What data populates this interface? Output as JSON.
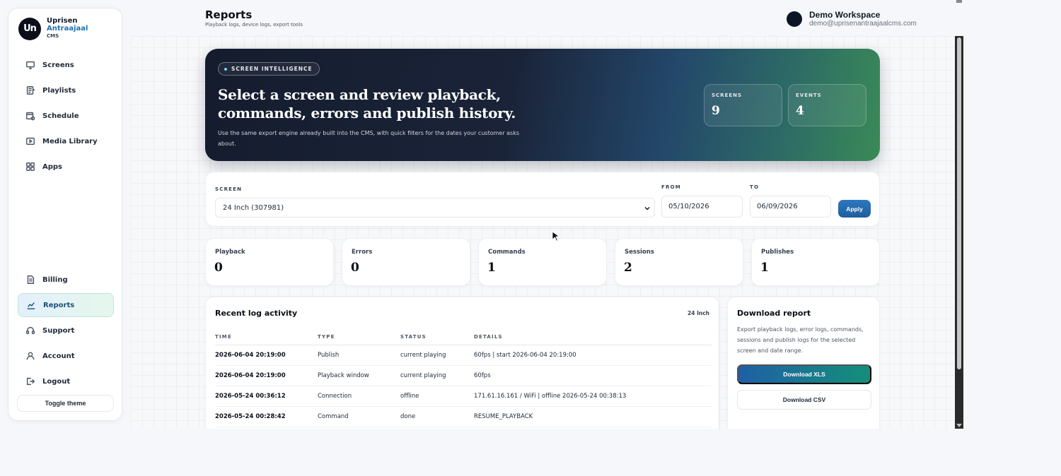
{
  "brand": {
    "logo": "Un",
    "line1": "Uprisen",
    "line2": "Antraajaal",
    "line3": "CMS"
  },
  "sidebar": {
    "top_items": [
      {
        "label": "Screens",
        "icon": "monitor-icon"
      },
      {
        "label": "Playlists",
        "icon": "playlist-icon"
      },
      {
        "label": "Schedule",
        "icon": "calendar-icon"
      },
      {
        "label": "Media Library",
        "icon": "media-icon"
      },
      {
        "label": "Apps",
        "icon": "apps-icon"
      }
    ],
    "bottom_items": [
      {
        "label": "Billing",
        "icon": "document-icon"
      },
      {
        "label": "Reports",
        "icon": "chart-icon",
        "active": true
      },
      {
        "label": "Support",
        "icon": "headset-icon"
      },
      {
        "label": "Account",
        "icon": "user-icon"
      },
      {
        "label": "Logout",
        "icon": "logout-icon"
      }
    ],
    "toggle_theme": "Toggle theme"
  },
  "header": {
    "title": "Reports",
    "subtitle": "Playback logs, device logs, export tools",
    "workspace_name": "Demo Workspace",
    "workspace_email": "demo@uprisenantraajaalcms.com"
  },
  "hero": {
    "chip": "SCREEN INTELLIGENCE",
    "title": "Select a screen and review playback, commands, errors and publish history.",
    "description": "Use the same export engine already built into the CMS, with quick filters for the dates your customer asks about.",
    "stats": [
      {
        "label": "SCREENS",
        "value": "9"
      },
      {
        "label": "EVENTS",
        "value": "4"
      }
    ]
  },
  "filter": {
    "screen_label": "SCREEN",
    "screen_value": "24 Inch (307981)",
    "from_label": "FROM",
    "from_value": "05/10/2026",
    "to_label": "TO",
    "to_value": "06/09/2026",
    "apply": "Apply"
  },
  "metrics": [
    {
      "label": "Playback",
      "value": "0"
    },
    {
      "label": "Errors",
      "value": "0"
    },
    {
      "label": "Commands",
      "value": "1"
    },
    {
      "label": "Sessions",
      "value": "2"
    },
    {
      "label": "Publishes",
      "value": "1"
    }
  ],
  "log": {
    "title": "Recent log activity",
    "tag": "24 Inch",
    "columns": [
      "TIME",
      "TYPE",
      "STATUS",
      "DETAILS"
    ],
    "rows": [
      [
        "2026-06-04 20:19:00",
        "Publish",
        "current playing",
        "60fps | start 2026-06-04 20:19:00"
      ],
      [
        "2026-06-04 20:19:00",
        "Playback window",
        "current playing",
        "60fps"
      ],
      [
        "2026-05-24 00:36:12",
        "Connection",
        "offline",
        "171.61.16.161 / WiFi | offline 2026-05-24 00:38:13"
      ],
      [
        "2026-05-24 00:28:42",
        "Command",
        "done",
        "RESUME_PLAYBACK"
      ]
    ]
  },
  "download": {
    "title": "Download report",
    "description": "Export playback logs, error logs, commands, sessions and publish logs for the selected screen and date range.",
    "xls": "Download XLS",
    "csv": "Download CSV"
  }
}
